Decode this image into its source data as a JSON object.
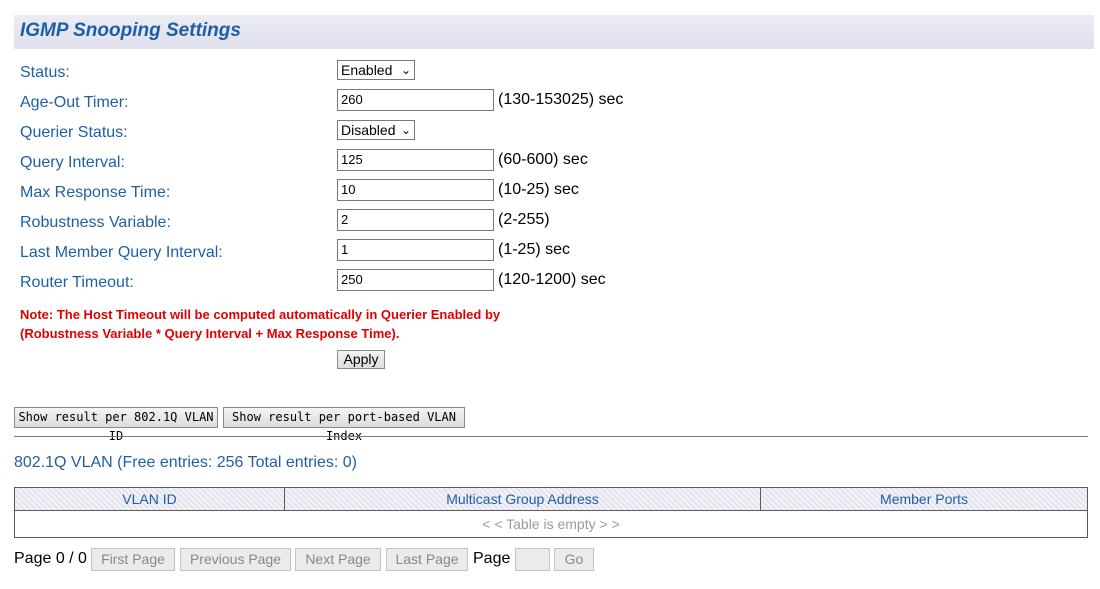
{
  "title": "IGMP Snooping Settings",
  "fields": {
    "status": {
      "label": "Status:",
      "value": "Enabled"
    },
    "age_out": {
      "label": "Age-Out Timer:",
      "value": "260",
      "hint": "(130-153025) sec"
    },
    "querier": {
      "label": "Querier Status:",
      "value": "Disabled"
    },
    "query_interval": {
      "label": "Query Interval:",
      "value": "125",
      "hint": "(60-600) sec"
    },
    "max_response": {
      "label": "Max Response Time:",
      "value": "10",
      "hint": "(10-25) sec"
    },
    "robustness": {
      "label": "Robustness Variable:",
      "value": "2",
      "hint": "(2-255)"
    },
    "last_member": {
      "label": "Last Member Query Interval:",
      "value": "1",
      "hint": "(1-25) sec"
    },
    "router_timeout": {
      "label": "Router Timeout:",
      "value": "250",
      "hint": "(120-1200) sec"
    }
  },
  "note": {
    "line1": "Note: The Host Timeout will be computed automatically in Querier Enabled by",
    "line2": "(Robustness Variable * Query Interval + Max Response Time)."
  },
  "apply_label": "Apply",
  "view_buttons": {
    "per_vlan": "Show result per 802.1Q VLAN ID",
    "per_port": "Show result per port-based VLAN Index"
  },
  "vlan_heading": "802.1Q VLAN (Free entries: 256 Total entries: 0)",
  "table": {
    "headers": [
      "VLAN ID",
      "Multicast Group Address",
      "Member Ports"
    ],
    "empty": "< < Table is empty > >"
  },
  "pager": {
    "status": "Page 0 / 0",
    "first": "First Page",
    "previous": "Previous Page",
    "next": "Next Page",
    "last": "Last Page",
    "page_label": "Page",
    "page_value": "",
    "go": "Go"
  },
  "icons": {
    "select_arrow": "chevron-down-icon"
  }
}
